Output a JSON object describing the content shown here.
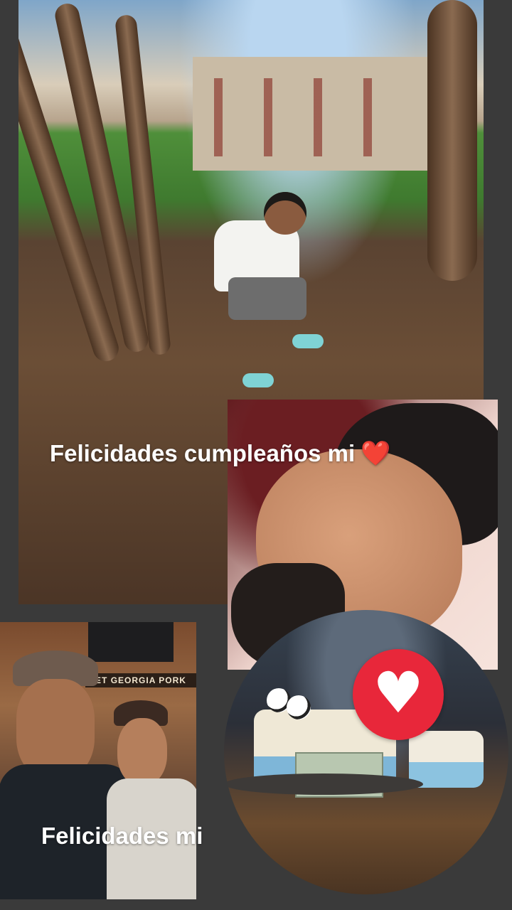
{
  "story": {
    "captions": {
      "top": "Felicidades cumpleaños mi",
      "top_emoji": "❤️",
      "bottom": "Felicidades mi"
    },
    "photos": {
      "couple": {
        "sign_text": "ET  GEORGIA PORK"
      }
    },
    "badge": {
      "icon": "heart-icon",
      "color": "#e8273a"
    }
  }
}
